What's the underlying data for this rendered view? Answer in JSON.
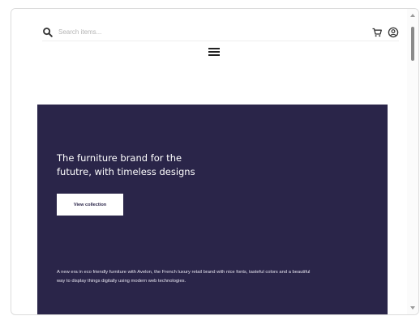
{
  "header": {
    "search": {
      "placeholder": "Search items..."
    },
    "icons": {
      "search": "search-icon",
      "cart": "cart-icon",
      "account": "user-circle-icon",
      "menu": "hamburger-menu-icon"
    }
  },
  "hero": {
    "title": "The furniture brand for the fututre, with timeless designs",
    "button_label": "View collection",
    "description": "A new era in eco friendly furniture with Avelon, the French luxury retail brand with nice fonts, tasteful colors and a beautiful way to display things digitally using modern web technologies.",
    "background_color": "#2a2549"
  }
}
